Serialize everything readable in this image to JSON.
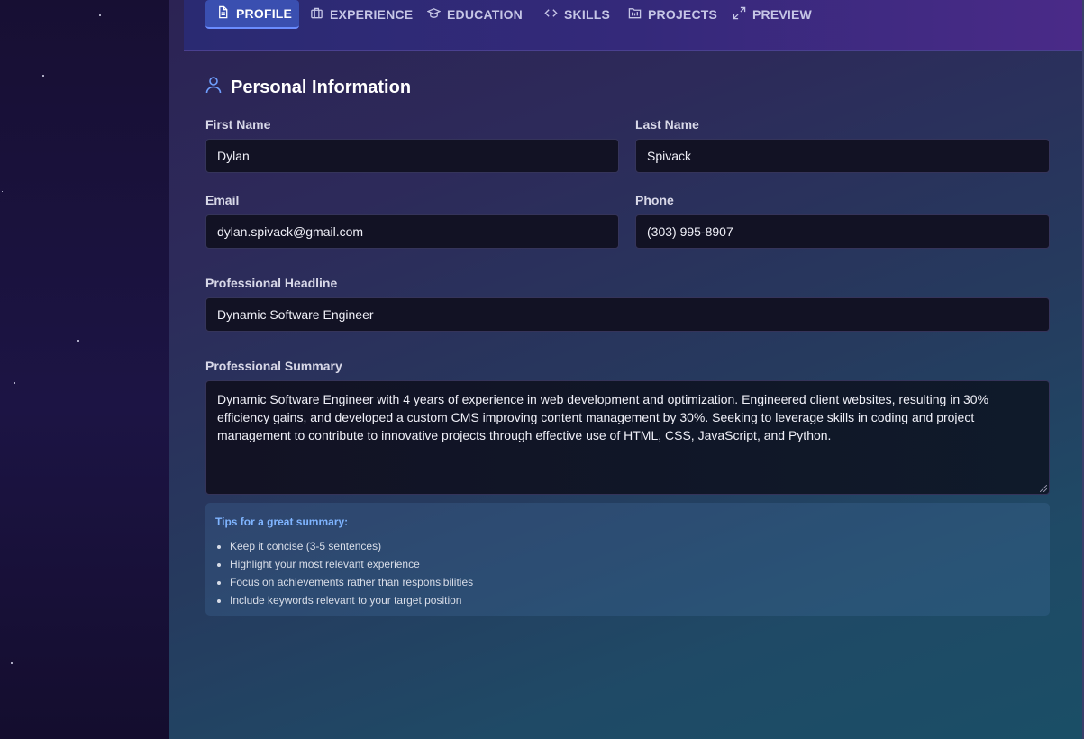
{
  "nav": {
    "tabs": [
      {
        "label": "PROFILE",
        "icon": "document-icon",
        "active": true
      },
      {
        "label": "EXPERIENCE",
        "icon": "briefcase-icon",
        "active": false
      },
      {
        "label": "EDUCATION",
        "icon": "graduation-cap-icon",
        "active": false
      },
      {
        "label": "SKILLS",
        "icon": "code-icon",
        "active": false
      },
      {
        "label": "PROJECTS",
        "icon": "folder-icon",
        "active": false
      },
      {
        "label": "PREVIEW",
        "icon": "expand-icon",
        "active": false
      }
    ]
  },
  "section": {
    "title": "Personal Information",
    "icon": "user-icon"
  },
  "form": {
    "first_name": {
      "label": "First Name",
      "value": "Dylan"
    },
    "last_name": {
      "label": "Last Name",
      "value": "Spivack"
    },
    "email": {
      "label": "Email",
      "value": "dylan.spivack@gmail.com"
    },
    "phone": {
      "label": "Phone",
      "value": "(303) 995-8907"
    },
    "headline": {
      "label": "Professional Headline",
      "value": "Dynamic Software Engineer"
    },
    "summary": {
      "label": "Professional Summary",
      "value": "Dynamic Software Engineer with 4 years of experience in web development and optimization. Engineered client websites, resulting in 30% efficiency gains, and developed a custom CMS improving content management by 30%. Seeking to leverage skills in coding and project management to contribute to innovative projects through effective use of HTML, CSS, JavaScript, and Python."
    }
  },
  "tips": {
    "title": "Tips for a great summary:",
    "items": [
      "Keep it concise (3-5 sentences)",
      "Highlight your most relevant experience",
      "Focus on achievements rather than responsibilities",
      "Include keywords relevant to your target position"
    ]
  },
  "colors": {
    "accent": "#3a4fb0",
    "tips_title": "#7fb4ff",
    "input_bg": "#121224"
  }
}
